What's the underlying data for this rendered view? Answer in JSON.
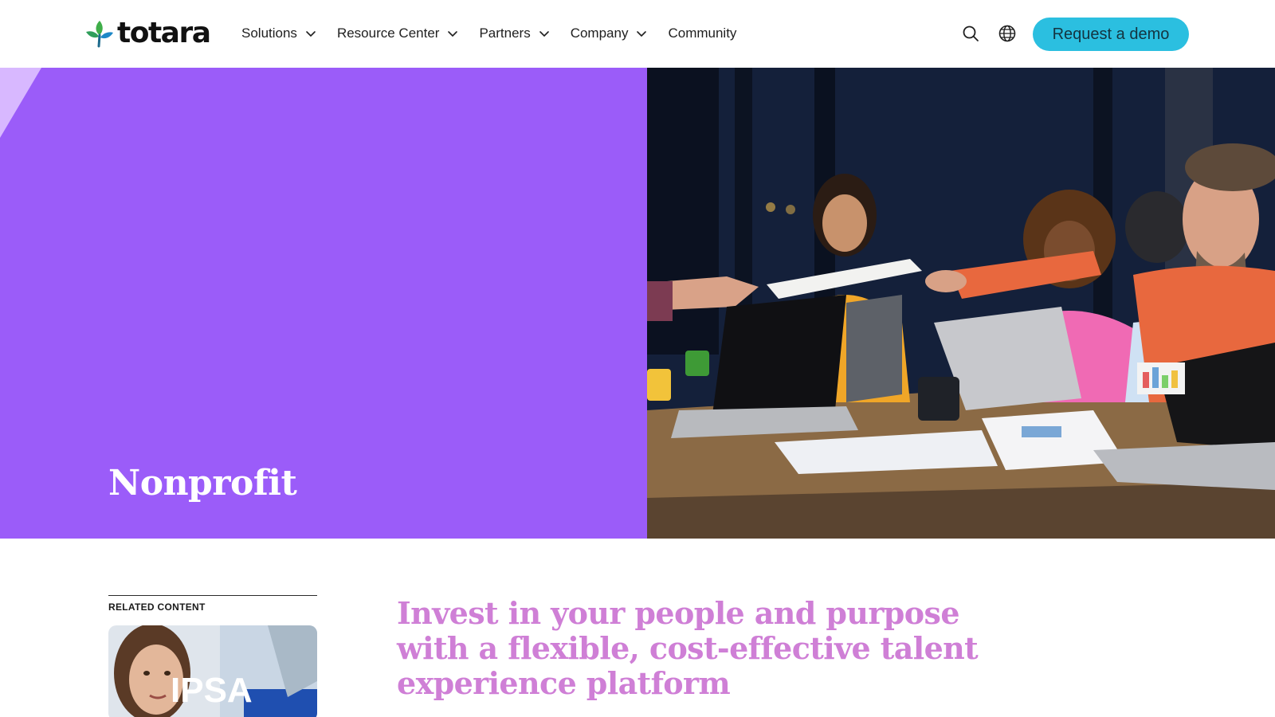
{
  "header": {
    "logo_text": "totara",
    "nav": [
      {
        "label": "Solutions",
        "has_dropdown": true
      },
      {
        "label": "Resource Center",
        "has_dropdown": true
      },
      {
        "label": "Partners",
        "has_dropdown": true
      },
      {
        "label": "Company",
        "has_dropdown": true
      },
      {
        "label": "Community",
        "has_dropdown": false
      }
    ],
    "search_icon": "search-icon",
    "language_icon": "globe-icon",
    "cta_label": "Request a demo"
  },
  "hero": {
    "title": "Nonprofit"
  },
  "related": {
    "label": "RELATED CONTENT",
    "card_logo_text": "IPSA"
  },
  "main": {
    "headline": "Invest in your people and purpose with a flexible, cost-effective talent experience platform"
  },
  "colors": {
    "brand_purple": "#9b5cf9",
    "cta_cyan": "#2bbfe0",
    "headline_pink": "#cf7fd6",
    "logo_green": "#3fae49",
    "logo_blue": "#1e88c7"
  }
}
